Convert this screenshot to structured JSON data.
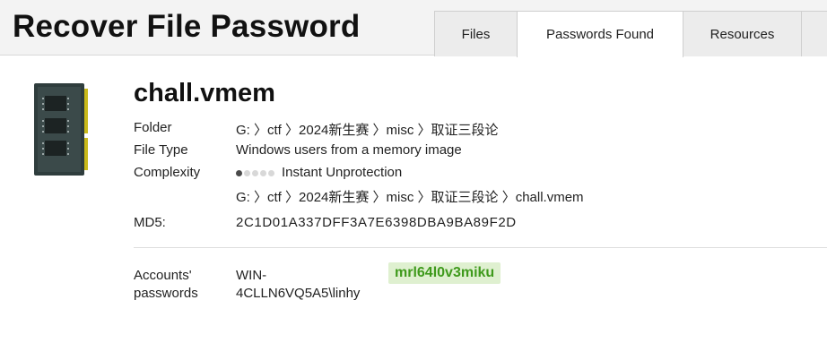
{
  "header": {
    "title": "Recover File Password"
  },
  "tabs": [
    {
      "label": "Files",
      "active": false
    },
    {
      "label": "Passwords Found",
      "active": true
    },
    {
      "label": "Resources",
      "active": false
    },
    {
      "label": "",
      "active": false
    }
  ],
  "file": {
    "icon": "memory-module-icon",
    "name": "chall.vmem",
    "folder_label": "Folder",
    "folder_value": "G: 〉ctf 〉2024新生赛 〉misc 〉取证三段论",
    "type_label": "File Type",
    "type_value": "Windows users from a memory image",
    "complexity_label": "Complexity",
    "complexity_level": 1,
    "complexity_max": 5,
    "complexity_value": "Instant Unprotection",
    "full_path": "G: 〉ctf 〉2024新生赛 〉misc 〉取证三段论 〉chall.vmem",
    "md5_label": "MD5:",
    "md5_value": "2C1D01A337DFF3A7E6398DBA9BA89F2D"
  },
  "accounts": {
    "label_line1": "Accounts'",
    "label_line2": "passwords",
    "user_line1": "WIN-",
    "user_line2": "4CLLN6VQ5A5\\linhy",
    "password": "mrl64l0v3miku"
  },
  "colors": {
    "password_bg": "#dff0d0",
    "password_text": "#3f9a1c",
    "header_bg": "#f3f3f3"
  }
}
